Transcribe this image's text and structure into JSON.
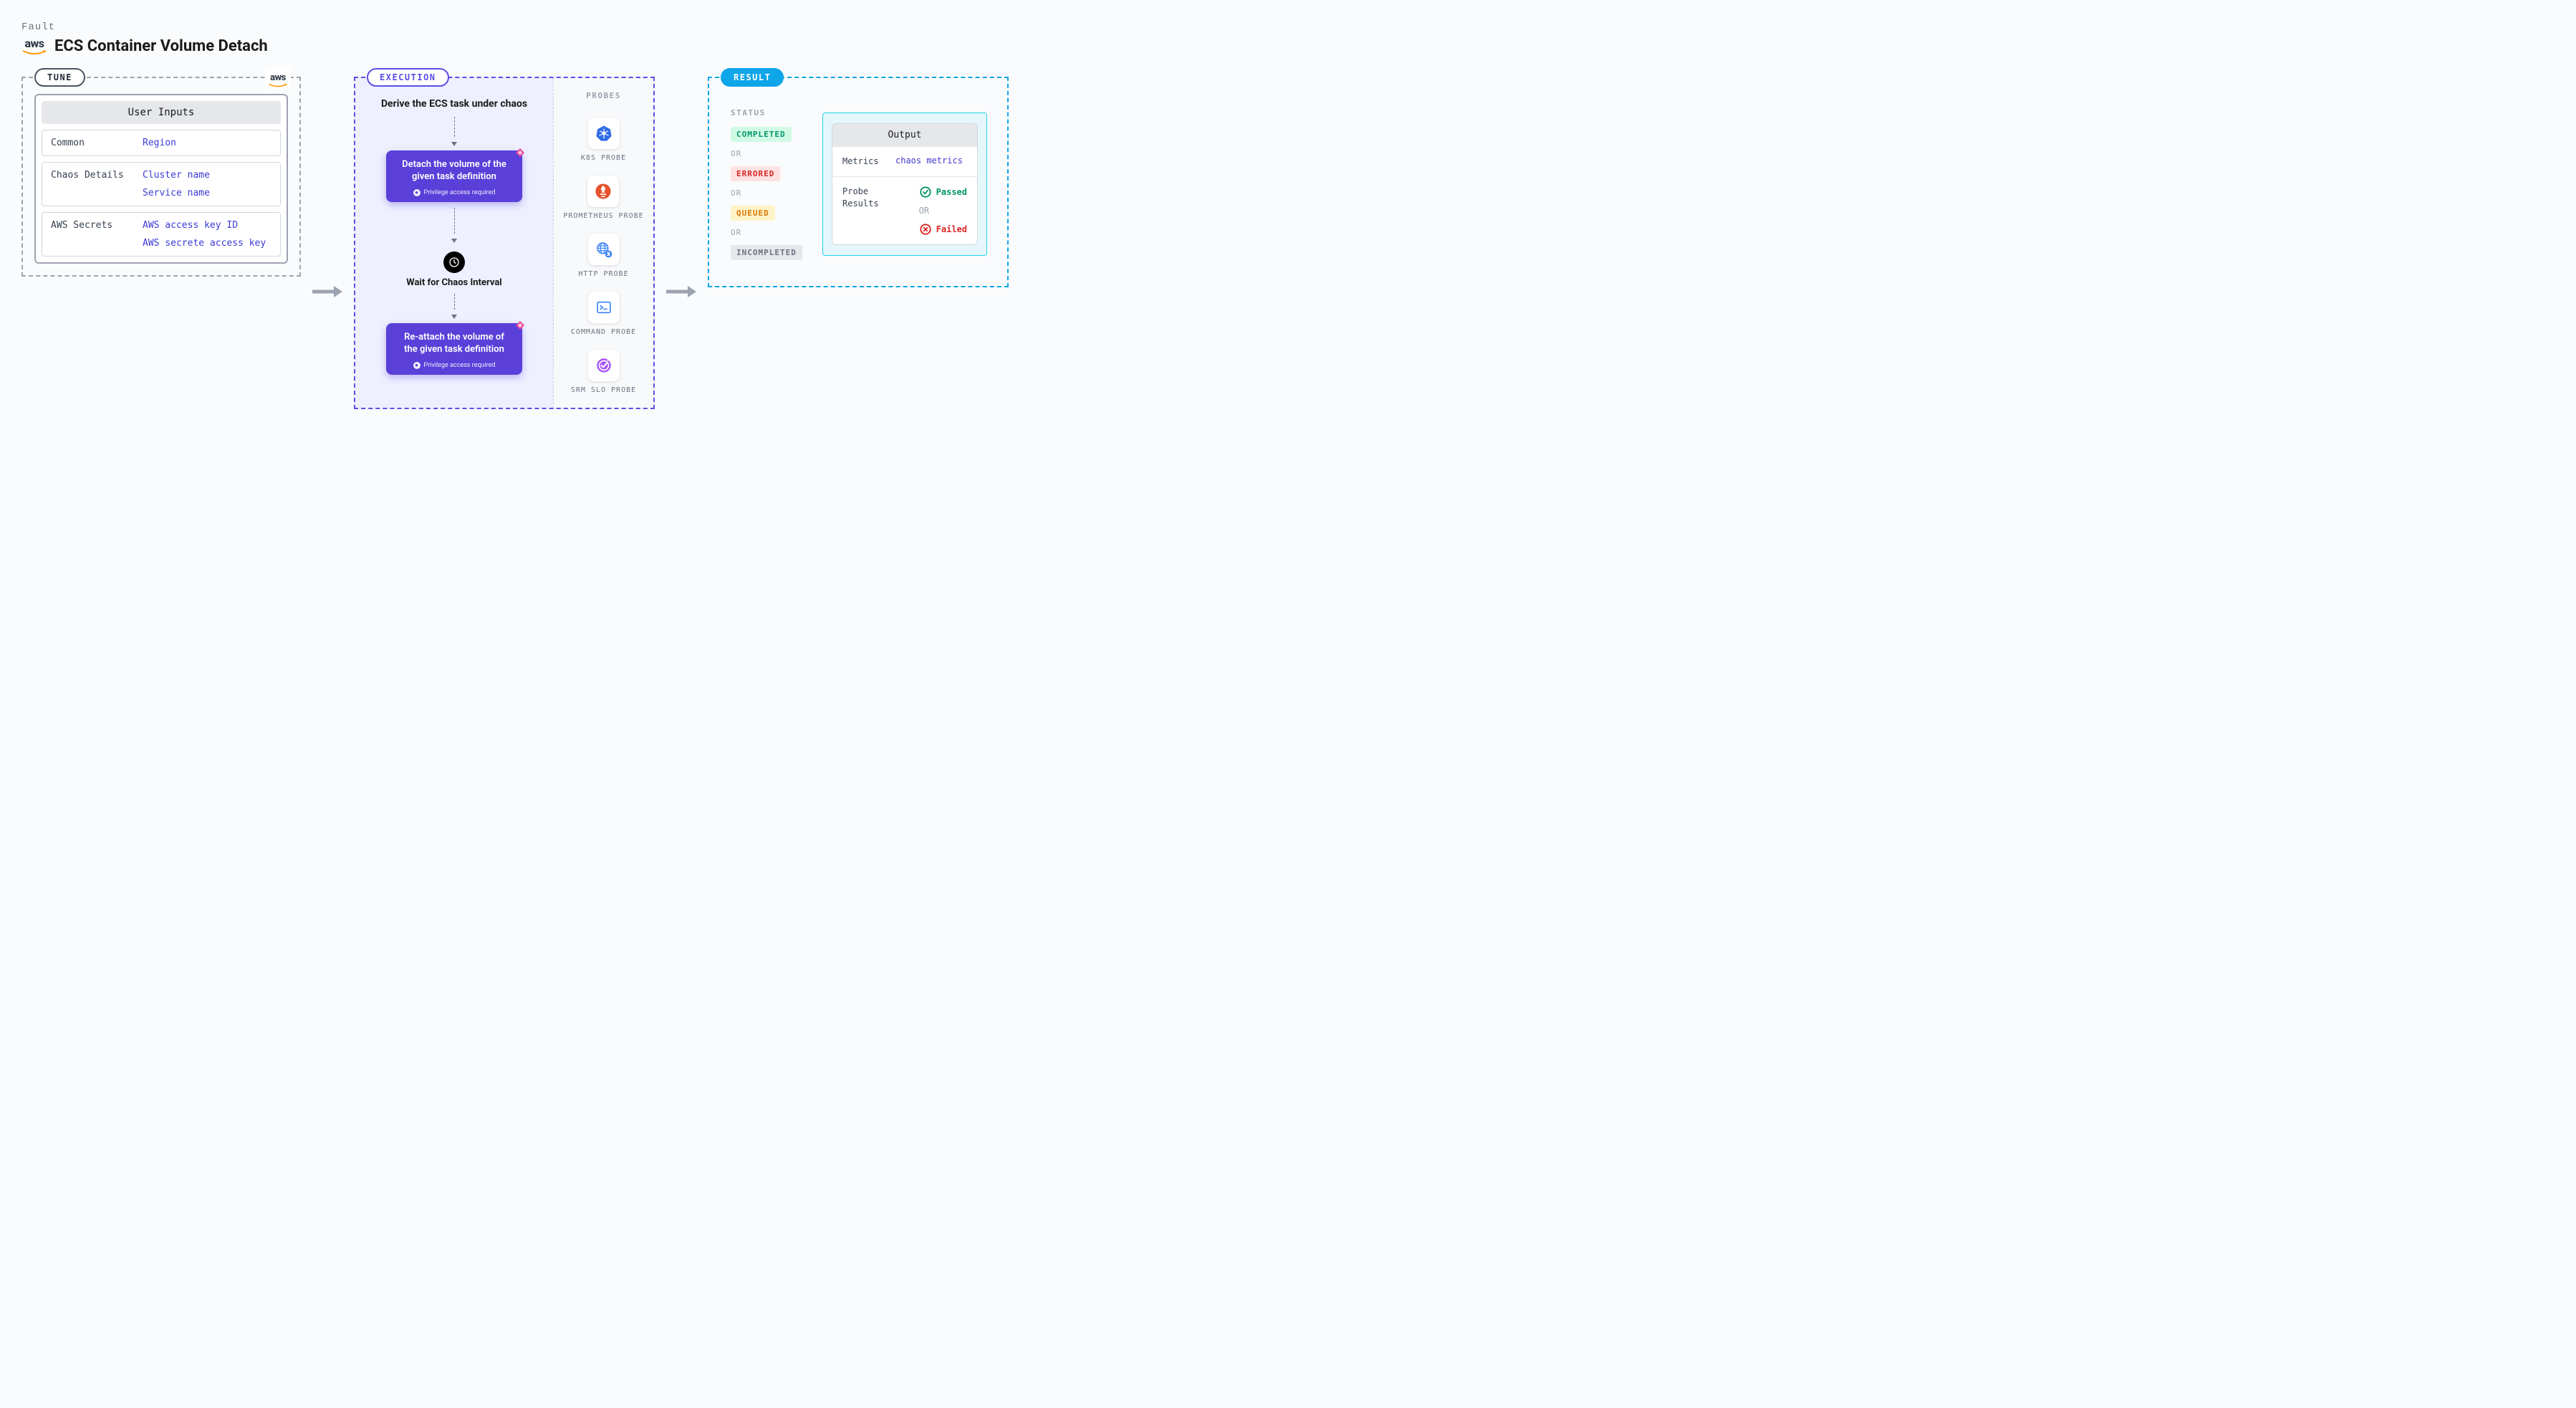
{
  "header": {
    "label": "Fault",
    "title": "ECS Container Volume Detach",
    "provider_logo_text": "aws"
  },
  "tune": {
    "badge": "TUNE",
    "corner_logo_text": "aws",
    "card_title": "User Inputs",
    "rows": [
      {
        "label": "Common",
        "values": [
          "Region"
        ]
      },
      {
        "label": "Chaos Details",
        "values": [
          "Cluster name",
          "Service name"
        ]
      },
      {
        "label": "AWS Secrets",
        "values": [
          "AWS access key ID",
          "AWS secrete access key"
        ]
      }
    ]
  },
  "execution": {
    "badge": "EXECUTION",
    "step_derive": "Derive the ECS task under chaos",
    "action_detach": "Detach the volume of the given task definition",
    "privilege_note": "Privilege access required",
    "wait_label": "Wait for Chaos Interval",
    "action_reattach": "Re-attach the volume of the given task definition",
    "probes_label": "PROBES",
    "probes": [
      {
        "name": "K8S PROBE",
        "icon": "kubernetes"
      },
      {
        "name": "PROMETHEUS PROBE",
        "icon": "prometheus"
      },
      {
        "name": "HTTP PROBE",
        "icon": "http"
      },
      {
        "name": "COMMAND PROBE",
        "icon": "command"
      },
      {
        "name": "SRM SLO PROBE",
        "icon": "srm"
      }
    ]
  },
  "result": {
    "badge": "RESULT",
    "status_label": "STATUS",
    "or_text": "OR",
    "statuses": [
      "COMPLETED",
      "ERRORED",
      "QUEUED",
      "INCOMPLETED"
    ],
    "output_title": "Output",
    "metrics_label": "Metrics",
    "metrics_value": "chaos metrics",
    "probe_results_label": "Probe Results",
    "passed_label": "Passed",
    "failed_label": "Failed"
  }
}
